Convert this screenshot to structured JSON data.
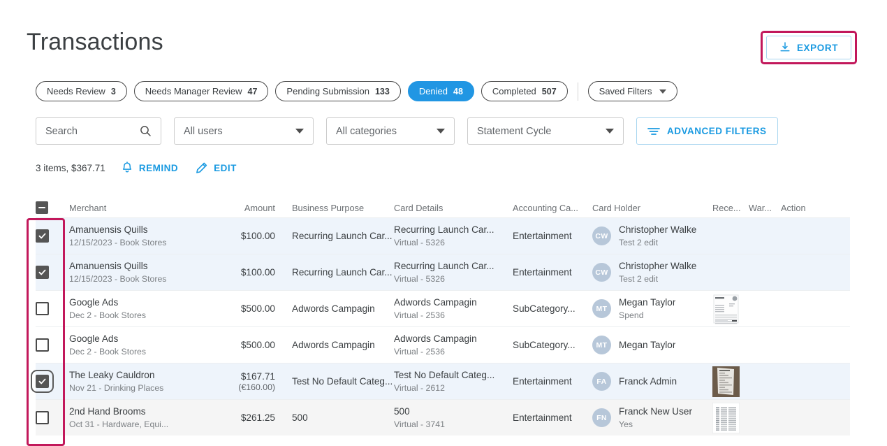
{
  "header": {
    "title": "Transactions",
    "export_label": "EXPORT",
    "export_icon": "download-icon"
  },
  "chips": [
    {
      "label": "Needs Review",
      "count": "3",
      "active": false
    },
    {
      "label": "Needs Manager Review",
      "count": "47",
      "active": false
    },
    {
      "label": "Pending Submission",
      "count": "133",
      "active": false
    },
    {
      "label": "Denied",
      "count": "48",
      "active": true
    },
    {
      "label": "Completed",
      "count": "507",
      "active": false
    }
  ],
  "saved_filters": {
    "label": "Saved Filters",
    "icon": "chevron-down-icon"
  },
  "filters": {
    "search_placeholder": "Search",
    "search_value": "",
    "search_icon": "search-icon",
    "users": "All users",
    "categories": "All categories",
    "cycle": "Statement Cycle",
    "advanced_label": "ADVANCED FILTERS",
    "advanced_icon": "filter-icon"
  },
  "actionbar": {
    "summary": "3 items, $367.71",
    "remind_label": "REMIND",
    "remind_icon": "bell-icon",
    "edit_label": "EDIT",
    "edit_icon": "pencil-icon"
  },
  "table": {
    "headers": {
      "merchant": "Merchant",
      "amount": "Amount",
      "business_purpose": "Business Purpose",
      "card_details": "Card Details",
      "accounting_category": "Accounting Ca...",
      "card_holder": "Card Holder",
      "receipt": "Rece...",
      "warning": "War...",
      "action": "Action"
    },
    "select_all_state": "indeterminate",
    "rows": [
      {
        "selected": true,
        "focused": false,
        "hovered": false,
        "merchant": "Amanuensis Quills",
        "merchant_sub": "12/15/2023 - Book Stores",
        "amount": "$100.00",
        "amount_sub": "",
        "business_purpose": "Recurring Launch Car...",
        "card_details": "Recurring Launch Car...",
        "card_details_sub": "Virtual - 5326",
        "accounting_category": "Entertainment",
        "holder_initials": "CW",
        "holder_name": "Christopher Walke",
        "holder_sub": "Test 2 edit",
        "receipt": "none"
      },
      {
        "selected": true,
        "focused": false,
        "hovered": false,
        "merchant": "Amanuensis Quills",
        "merchant_sub": "12/15/2023 - Book Stores",
        "amount": "$100.00",
        "amount_sub": "",
        "business_purpose": "Recurring Launch Car...",
        "card_details": "Recurring Launch Car...",
        "card_details_sub": "Virtual - 5326",
        "accounting_category": "Entertainment",
        "holder_initials": "CW",
        "holder_name": "Christopher Walke",
        "holder_sub": "Test 2 edit",
        "receipt": "none"
      },
      {
        "selected": false,
        "focused": false,
        "hovered": false,
        "merchant": "Google Ads",
        "merchant_sub": "Dec 2 - Book Stores",
        "amount": "$500.00",
        "amount_sub": "",
        "business_purpose": "Adwords Campagin",
        "card_details": "Adwords Campagin",
        "card_details_sub": "Virtual - 2536",
        "accounting_category": "SubCategory...",
        "holder_initials": "MT",
        "holder_name": "Megan Taylor",
        "holder_sub": "Spend",
        "receipt": "invoice"
      },
      {
        "selected": false,
        "focused": false,
        "hovered": false,
        "merchant": "Google Ads",
        "merchant_sub": "Dec 2 - Book Stores",
        "amount": "$500.00",
        "amount_sub": "",
        "business_purpose": "Adwords Campagin",
        "card_details": "Adwords Campagin",
        "card_details_sub": "Virtual - 2536",
        "accounting_category": "SubCategory...",
        "holder_initials": "MT",
        "holder_name": "Megan Taylor",
        "holder_sub": "",
        "receipt": "none"
      },
      {
        "selected": true,
        "focused": true,
        "hovered": false,
        "merchant": "The Leaky Cauldron",
        "merchant_sub": "Nov 21 - Drinking Places",
        "amount": "$167.71",
        "amount_sub": "(€160.00)",
        "business_purpose": "Test No Default Categ...",
        "card_details": "Test No Default Categ...",
        "card_details_sub": "Virtual - 2612",
        "accounting_category": "Entertainment",
        "holder_initials": "FA",
        "holder_name": "Franck Admin",
        "holder_sub": "",
        "receipt": "photo"
      },
      {
        "selected": false,
        "focused": false,
        "hovered": true,
        "merchant": "2nd Hand Brooms",
        "merchant_sub": "Oct 31 - Hardware, Equi...",
        "amount": "$261.25",
        "amount_sub": "",
        "business_purpose": "500",
        "card_details": "500",
        "card_details_sub": "Virtual - 3741",
        "accounting_category": "Entertainment",
        "holder_initials": "FN",
        "holder_name": "Franck New User",
        "holder_sub": "Yes",
        "receipt": "spreadsheet"
      }
    ]
  },
  "colors": {
    "accent_blue": "#1a9ae1",
    "chip_active": "#2196e3",
    "annotation": "#c2185b",
    "row_selected": "#eef4fb"
  }
}
